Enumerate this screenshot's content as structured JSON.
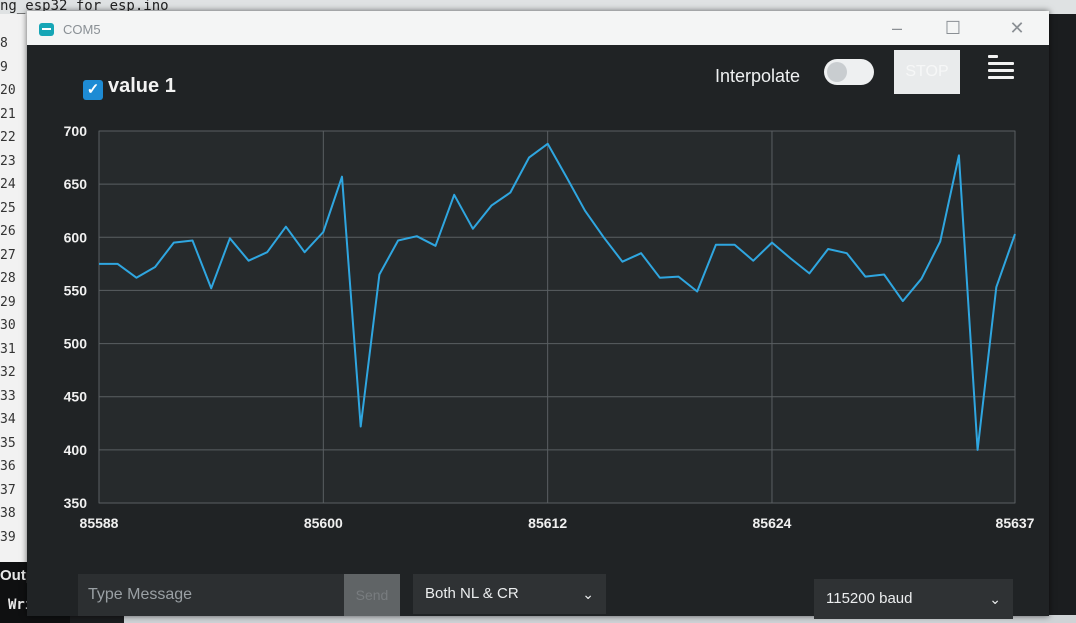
{
  "ide": {
    "filename": "ng_esp32_for_esp.ino",
    "line_numbers": [
      "8",
      "9",
      "20",
      "21",
      "22",
      "23",
      "24",
      "25",
      "26",
      "27",
      "28",
      "29",
      "30",
      "31",
      "32",
      "33",
      "34",
      "35",
      "36",
      "37",
      "38",
      "39"
    ],
    "output_label": "Output",
    "writing_label": "Writi"
  },
  "window": {
    "title": "COM5",
    "minimize": "–",
    "maximize": "☐",
    "close": "✕"
  },
  "toolbar": {
    "legend_label": "value 1",
    "legend_checked": true,
    "interpolate_label": "Interpolate",
    "interpolate_on": true,
    "stop_label": "STOP",
    "menu_icon": "clear-output-icon"
  },
  "chart_data": {
    "type": "line",
    "title": "",
    "xlabel": "",
    "ylabel": "",
    "ylim": [
      350,
      700
    ],
    "xlim": [
      85588,
      85637
    ],
    "yticks": [
      "700",
      "650",
      "600",
      "550",
      "500",
      "450",
      "400",
      "350"
    ],
    "xticks": [
      "85588",
      "85600",
      "85612",
      "85624",
      "85637"
    ],
    "grid": true,
    "series": [
      {
        "name": "value 1",
        "color": "#2fa6e0",
        "x": [
          85588,
          85589,
          85590,
          85591,
          85592,
          85593,
          85594,
          85595,
          85596,
          85597,
          85598,
          85599,
          85600,
          85601,
          85602,
          85603,
          85604,
          85605,
          85606,
          85607,
          85608,
          85609,
          85610,
          85611,
          85612,
          85613,
          85614,
          85615,
          85616,
          85617,
          85618,
          85619,
          85620,
          85621,
          85622,
          85623,
          85624,
          85625,
          85626,
          85627,
          85628,
          85629,
          85630,
          85631,
          85632,
          85633,
          85634,
          85635,
          85636,
          85637
        ],
        "values": [
          575,
          575,
          562,
          572,
          595,
          597,
          552,
          599,
          578,
          586,
          610,
          586,
          605,
          657,
          422,
          565,
          597,
          601,
          592,
          640,
          608,
          630,
          642,
          675,
          688,
          657,
          625,
          600,
          577,
          585,
          562,
          563,
          549,
          593,
          593,
          578,
          595,
          580,
          566,
          589,
          585,
          563,
          565,
          540,
          561,
          596,
          677,
          400,
          553,
          603
        ]
      }
    ]
  },
  "controls": {
    "message_placeholder": "Type Message",
    "send_label": "Send",
    "line_ending": "Both NL & CR",
    "baud": "115200 baud"
  }
}
